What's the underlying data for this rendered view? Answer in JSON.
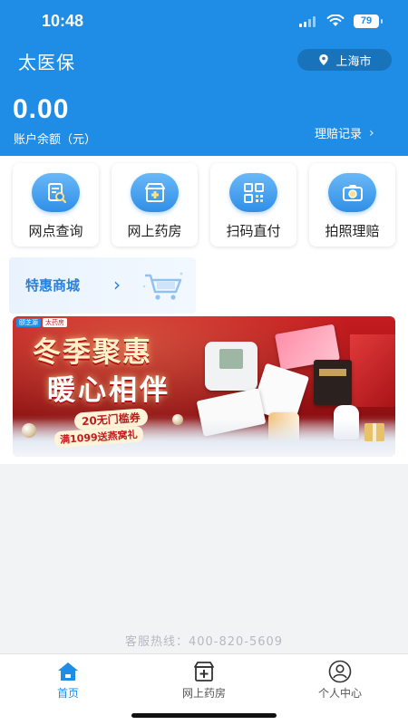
{
  "status_bar": {
    "time": "10:48",
    "battery": "79"
  },
  "header": {
    "app_title": "太医保",
    "location": "上海市",
    "balance_value": "0.00",
    "balance_label": "账户余额（元）",
    "claims_link": "理赔记录"
  },
  "quick_actions": [
    {
      "label": "网点查询",
      "icon": "search-document-icon"
    },
    {
      "label": "网上药房",
      "icon": "pharmacy-icon"
    },
    {
      "label": "扫码直付",
      "icon": "qr-code-icon"
    },
    {
      "label": "拍照理赔",
      "icon": "camera-icon"
    }
  ],
  "mall": {
    "label": "特惠商城",
    "icon": "shopping-cart-icon"
  },
  "banner": {
    "brand_1": "颐芝源",
    "brand_2": "太药房",
    "title_line1": "冬季聚惠",
    "title_line2": "暖心相伴",
    "coupon": "20无门槛券",
    "gift": "满1099送燕窝礼"
  },
  "footer": {
    "hotline": "客服热线：400-820-5609"
  },
  "tabbar": {
    "active_color": "#1f8de5",
    "tabs": [
      {
        "label": "首页",
        "icon": "home-icon"
      },
      {
        "label": "网上药房",
        "icon": "pharmacy-icon"
      },
      {
        "label": "个人中心",
        "icon": "person-icon"
      }
    ]
  },
  "colors": {
    "brand_blue": "#1f8de5",
    "banner_red": "#c61c20"
  }
}
